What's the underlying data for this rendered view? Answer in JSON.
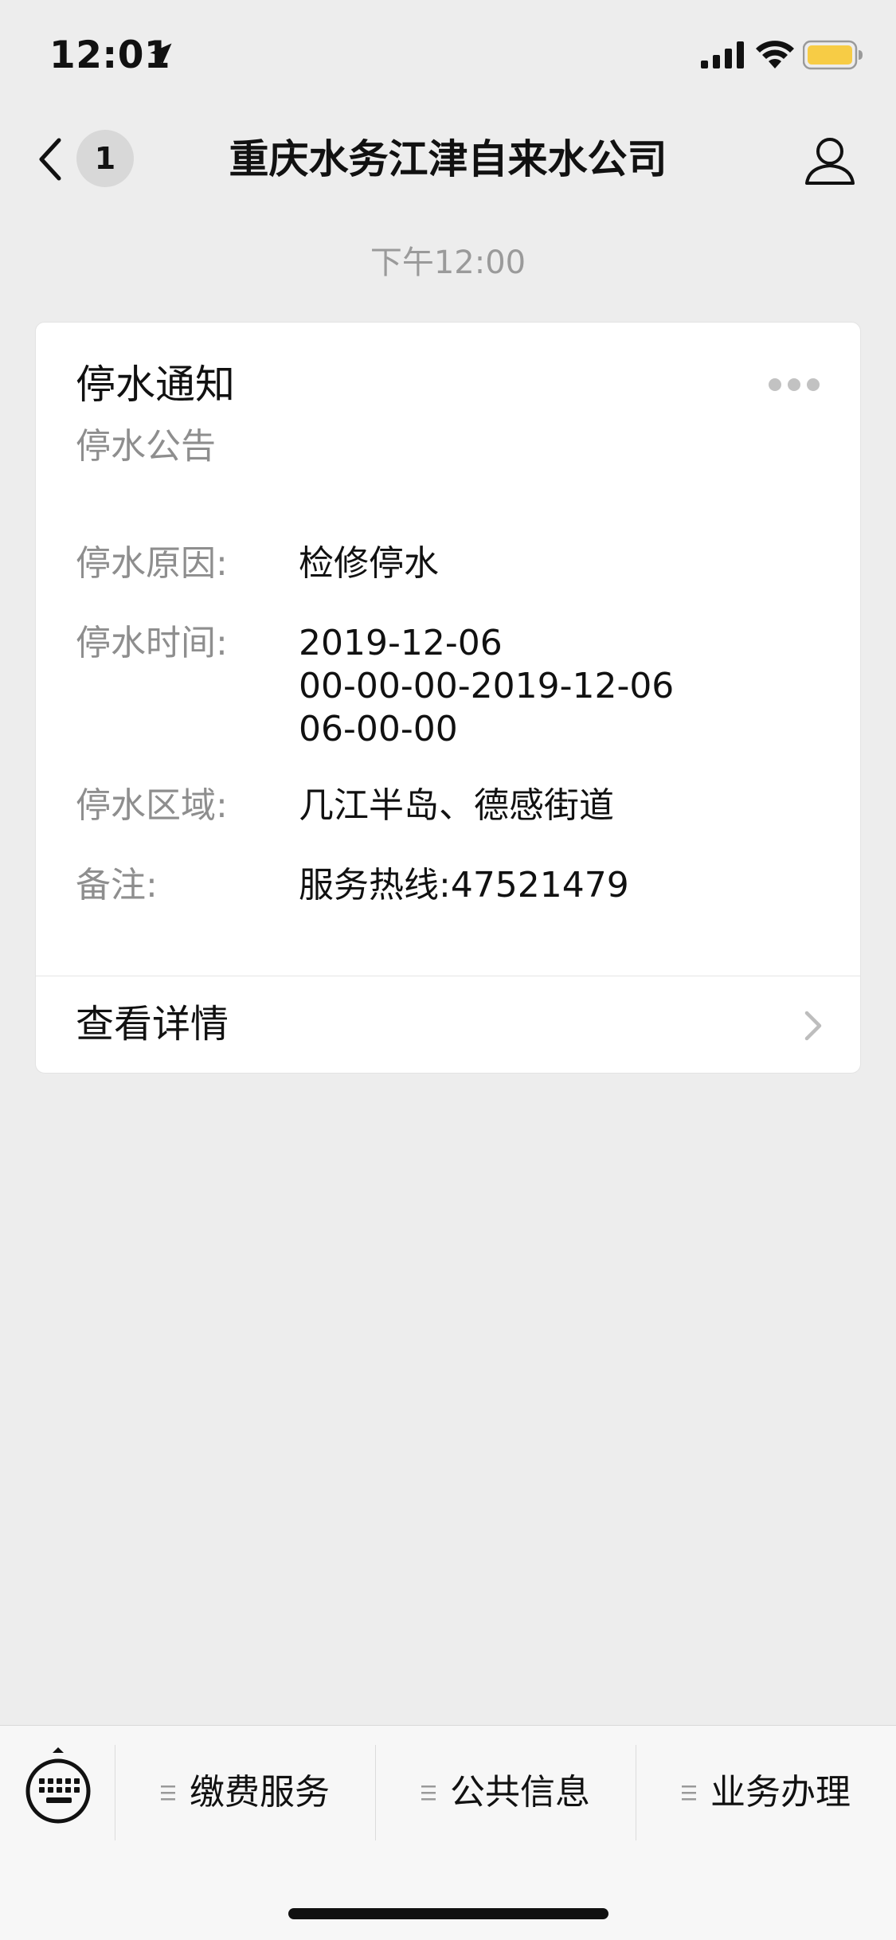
{
  "status_bar": {
    "time": "12:01"
  },
  "nav": {
    "badge": "1",
    "title": "重庆水务江津自来水公司"
  },
  "message": {
    "time": "下午12:00"
  },
  "card": {
    "title": "停水通知",
    "subtitle": "停水公告",
    "fields": [
      {
        "label": "停水原因:",
        "value": "检修停水"
      },
      {
        "label": "停水时间:",
        "value": [
          "2019-12-06",
          "00-00-00-2019-12-06",
          "06-00-00"
        ]
      },
      {
        "label": "停水区域:",
        "value": "几江半岛、德感街道"
      },
      {
        "label": "备注:",
        "value": "服务热线:47521479"
      }
    ],
    "detail_label": "查看详情"
  },
  "bottom_menu": {
    "items": [
      {
        "label": "缴费服务"
      },
      {
        "label": "公共信息"
      },
      {
        "label": "业务办理"
      }
    ]
  },
  "colors": {
    "background": "#EDEDED",
    "card": "#FFFFFF",
    "secondary_text": "#8E8E8E",
    "battery": "#F7CC45"
  }
}
